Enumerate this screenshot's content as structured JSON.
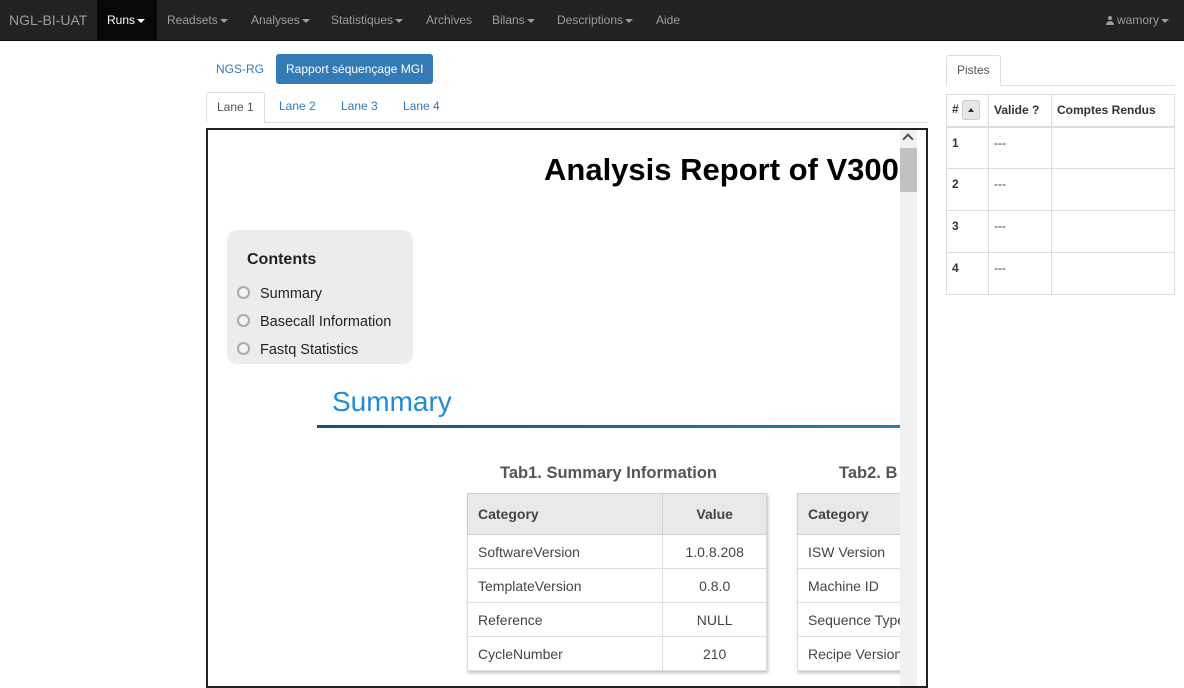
{
  "navbar": {
    "brand": "NGL-BI-UAT",
    "items": [
      "Runs",
      "Readsets",
      "Analyses",
      "Statistiques",
      "Archives",
      "Bilans",
      "Descriptions",
      "Aide"
    ],
    "user": "wamory"
  },
  "pills": [
    "NGS-RG",
    "Rapport séquençage MGI"
  ],
  "lanes": [
    "Lane 1",
    "Lane 2",
    "Lane 3",
    "Lane 4"
  ],
  "report": {
    "title": "Analysis Report of V300",
    "contents_title": "Contents",
    "toc": [
      "Summary",
      "Basecall Information",
      "Fastq Statistics"
    ],
    "section_title": "Summary",
    "tab1": {
      "caption": "Tab1. Summary Information",
      "headers": [
        "Category",
        "Value"
      ],
      "rows": [
        [
          "SoftwareVersion",
          "1.0.8.208"
        ],
        [
          "TemplateVersion",
          "0.8.0"
        ],
        [
          "Reference",
          "NULL"
        ],
        [
          "CycleNumber",
          "210"
        ]
      ]
    },
    "tab2": {
      "caption": "Tab2. B",
      "headers": [
        "Category"
      ],
      "rows": [
        "ISW Version",
        "Machine ID",
        "Sequence Type",
        "Recipe Version"
      ]
    }
  },
  "pistes": {
    "tab_label": "Pistes",
    "headers": [
      "#",
      "Valide ?",
      "Comptes Rendus"
    ],
    "rows": [
      {
        "num": "1",
        "valid": "---",
        "report": ""
      },
      {
        "num": "2",
        "valid": "---",
        "report": ""
      },
      {
        "num": "3",
        "valid": "---",
        "report": ""
      },
      {
        "num": "4",
        "valid": "---",
        "report": ""
      }
    ]
  }
}
